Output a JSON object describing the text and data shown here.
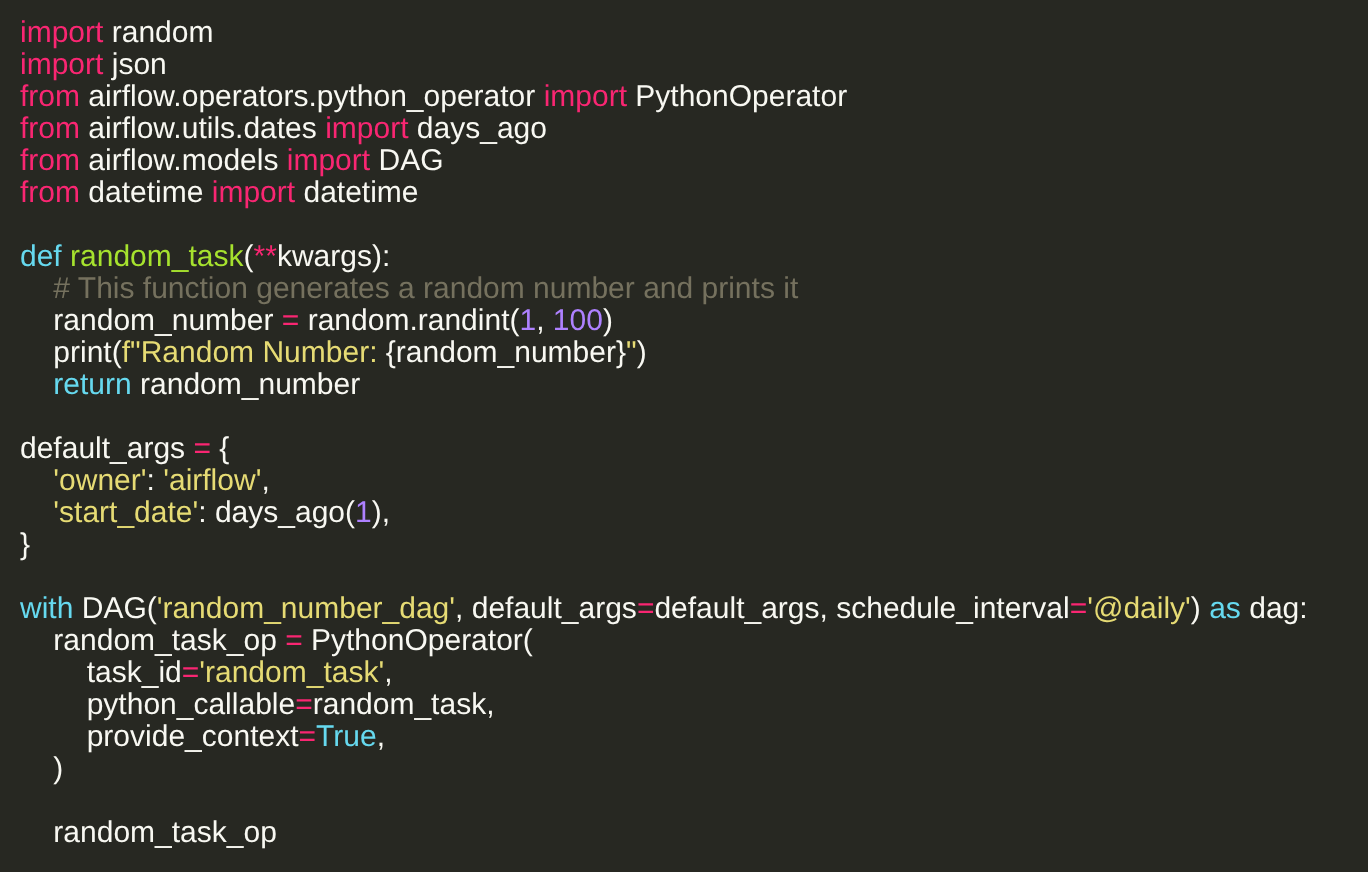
{
  "editor": {
    "lines": [
      {
        "kind": "code",
        "tokens": [
          {
            "kind": "keyword",
            "text": "import"
          },
          {
            "kind": "plain",
            "text": " random"
          }
        ]
      },
      {
        "kind": "code",
        "tokens": [
          {
            "kind": "keyword",
            "text": "import"
          },
          {
            "kind": "plain",
            "text": " json"
          }
        ]
      },
      {
        "kind": "code",
        "tokens": [
          {
            "kind": "keyword",
            "text": "from"
          },
          {
            "kind": "plain",
            "text": " airflow.operators.python_operator "
          },
          {
            "kind": "keyword",
            "text": "import"
          },
          {
            "kind": "plain",
            "text": " PythonOperator"
          }
        ]
      },
      {
        "kind": "code",
        "tokens": [
          {
            "kind": "keyword",
            "text": "from"
          },
          {
            "kind": "plain",
            "text": " airflow.utils.dates "
          },
          {
            "kind": "keyword",
            "text": "import"
          },
          {
            "kind": "plain",
            "text": " days_ago"
          }
        ]
      },
      {
        "kind": "code",
        "tokens": [
          {
            "kind": "keyword",
            "text": "from"
          },
          {
            "kind": "plain",
            "text": " airflow.models "
          },
          {
            "kind": "keyword",
            "text": "import"
          },
          {
            "kind": "plain",
            "text": " DAG"
          }
        ]
      },
      {
        "kind": "code",
        "tokens": [
          {
            "kind": "keyword",
            "text": "from"
          },
          {
            "kind": "plain",
            "text": " datetime "
          },
          {
            "kind": "keyword",
            "text": "import"
          },
          {
            "kind": "plain",
            "text": " datetime"
          }
        ]
      },
      {
        "kind": "blank"
      },
      {
        "kind": "code",
        "tokens": [
          {
            "kind": "builtin",
            "text": "def"
          },
          {
            "kind": "function",
            "text": " random_task"
          },
          {
            "kind": "plain",
            "text": "("
          },
          {
            "kind": "keyword",
            "text": "**"
          },
          {
            "kind": "plain",
            "text": "kwargs):"
          }
        ]
      },
      {
        "kind": "code",
        "tokens": [
          {
            "kind": "comment",
            "text": "    # This function generates a random number and prints it"
          }
        ]
      },
      {
        "kind": "code",
        "tokens": [
          {
            "kind": "plain",
            "text": "    random_number "
          },
          {
            "kind": "keyword",
            "text": "="
          },
          {
            "kind": "plain",
            "text": " random.randint("
          },
          {
            "kind": "number",
            "text": "1"
          },
          {
            "kind": "plain",
            "text": ", "
          },
          {
            "kind": "number",
            "text": "100"
          },
          {
            "kind": "plain",
            "text": ")"
          }
        ]
      },
      {
        "kind": "code",
        "tokens": [
          {
            "kind": "plain",
            "text": "    print("
          },
          {
            "kind": "string",
            "text": "f\"Random Number: "
          },
          {
            "kind": "plain",
            "text": "{random_number}"
          },
          {
            "kind": "string",
            "text": "\""
          },
          {
            "kind": "plain",
            "text": ")"
          }
        ]
      },
      {
        "kind": "code",
        "tokens": [
          {
            "kind": "builtin",
            "text": "    return"
          },
          {
            "kind": "plain",
            "text": " random_number"
          }
        ]
      },
      {
        "kind": "blank"
      },
      {
        "kind": "code",
        "tokens": [
          {
            "kind": "plain",
            "text": "default_args "
          },
          {
            "kind": "keyword",
            "text": "="
          },
          {
            "kind": "plain",
            "text": " {"
          }
        ]
      },
      {
        "kind": "code",
        "tokens": [
          {
            "kind": "string",
            "text": "    'owner'"
          },
          {
            "kind": "plain",
            "text": ": "
          },
          {
            "kind": "string",
            "text": "'airflow'"
          },
          {
            "kind": "plain",
            "text": ","
          }
        ]
      },
      {
        "kind": "code",
        "tokens": [
          {
            "kind": "string",
            "text": "    'start_date'"
          },
          {
            "kind": "plain",
            "text": ": days_ago("
          },
          {
            "kind": "number",
            "text": "1"
          },
          {
            "kind": "plain",
            "text": "),"
          }
        ]
      },
      {
        "kind": "code",
        "tokens": [
          {
            "kind": "plain",
            "text": "}"
          }
        ]
      },
      {
        "kind": "blank"
      },
      {
        "kind": "code",
        "tokens": [
          {
            "kind": "builtin",
            "text": "with"
          },
          {
            "kind": "plain",
            "text": " DAG("
          },
          {
            "kind": "string",
            "text": "'random_number_dag'"
          },
          {
            "kind": "plain",
            "text": ", default_args"
          },
          {
            "kind": "keyword",
            "text": "="
          },
          {
            "kind": "plain",
            "text": "default_args, schedule_interval"
          },
          {
            "kind": "keyword",
            "text": "="
          },
          {
            "kind": "string",
            "text": "'@daily'"
          },
          {
            "kind": "plain",
            "text": ") "
          },
          {
            "kind": "builtin",
            "text": "as"
          },
          {
            "kind": "plain",
            "text": " dag:"
          }
        ]
      },
      {
        "kind": "code",
        "tokens": [
          {
            "kind": "plain",
            "text": "    random_task_op "
          },
          {
            "kind": "keyword",
            "text": "="
          },
          {
            "kind": "plain",
            "text": " PythonOperator("
          }
        ]
      },
      {
        "kind": "code",
        "tokens": [
          {
            "kind": "plain",
            "text": "        task_id"
          },
          {
            "kind": "keyword",
            "text": "="
          },
          {
            "kind": "string",
            "text": "'random_task'"
          },
          {
            "kind": "plain",
            "text": ","
          }
        ]
      },
      {
        "kind": "code",
        "tokens": [
          {
            "kind": "plain",
            "text": "        python_callable"
          },
          {
            "kind": "keyword",
            "text": "="
          },
          {
            "kind": "plain",
            "text": "random_task,"
          }
        ]
      },
      {
        "kind": "code",
        "tokens": [
          {
            "kind": "plain",
            "text": "        provide_context"
          },
          {
            "kind": "keyword",
            "text": "="
          },
          {
            "kind": "builtin",
            "text": "True"
          },
          {
            "kind": "plain",
            "text": ","
          }
        ]
      },
      {
        "kind": "code",
        "tokens": [
          {
            "kind": "plain",
            "text": "    )"
          }
        ]
      },
      {
        "kind": "blank"
      },
      {
        "kind": "code",
        "tokens": [
          {
            "kind": "plain",
            "text": "    random_task_op"
          }
        ]
      }
    ]
  }
}
